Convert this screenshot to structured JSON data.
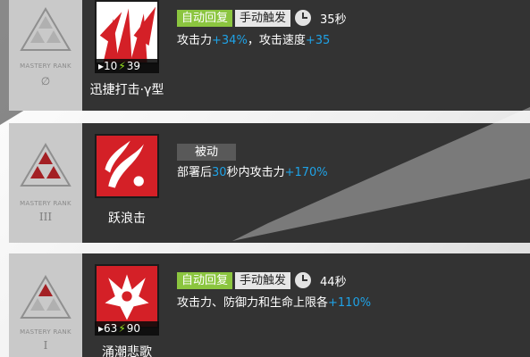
{
  "colors": {
    "panel": "#333333",
    "rank_panel": "#c9c9c9",
    "tag_auto_recovery": "#8bc53f",
    "tag_manual": "#e6e6e6",
    "tag_passive": "#595959",
    "highlight": "#1fa2e6",
    "sp_bolt": "#9be31f",
    "skill_icon_red": "#d42027"
  },
  "skills": [
    {
      "rank_title": "MASTERY RANK",
      "rank_value": "0",
      "rank_display": "∅",
      "rank_filled_triangles": 0,
      "name": "迅捷打击·γ型",
      "icon": "swift-strike-icon",
      "sp_initial": "10",
      "sp_cost": "39",
      "tags": [
        "自动回复",
        "手动触发"
      ],
      "duration": "35秒",
      "desc_parts": [
        {
          "text": "攻击力",
          "hl": false
        },
        {
          "text": "+34%",
          "hl": true
        },
        {
          "text": "，攻击速度",
          "hl": false
        },
        {
          "text": "+35",
          "hl": true
        }
      ]
    },
    {
      "rank_title": "MASTERY RANK",
      "rank_value": "III",
      "rank_display": "III",
      "rank_filled_triangles": 3,
      "name": "跃浪击",
      "icon": "wave-leap-strike-icon",
      "tags": [
        "被动"
      ],
      "desc_parts": [
        {
          "text": "部署后",
          "hl": false
        },
        {
          "text": "30",
          "hl": true
        },
        {
          "text": "秒内攻击力",
          "hl": false
        },
        {
          "text": "+170%",
          "hl": true
        }
      ]
    },
    {
      "rank_title": "MASTERY RANK",
      "rank_value": "I",
      "rank_display": "I",
      "rank_filled_triangles": 1,
      "name": "涌潮悲歌",
      "icon": "tide-lament-icon",
      "sp_initial": "63",
      "sp_cost": "90",
      "tags": [
        "自动回复",
        "手动触发"
      ],
      "duration": "44秒",
      "desc_parts": [
        {
          "text": "攻击力、防御力和生命上限各",
          "hl": false
        },
        {
          "text": "+110%",
          "hl": true
        }
      ]
    }
  ]
}
